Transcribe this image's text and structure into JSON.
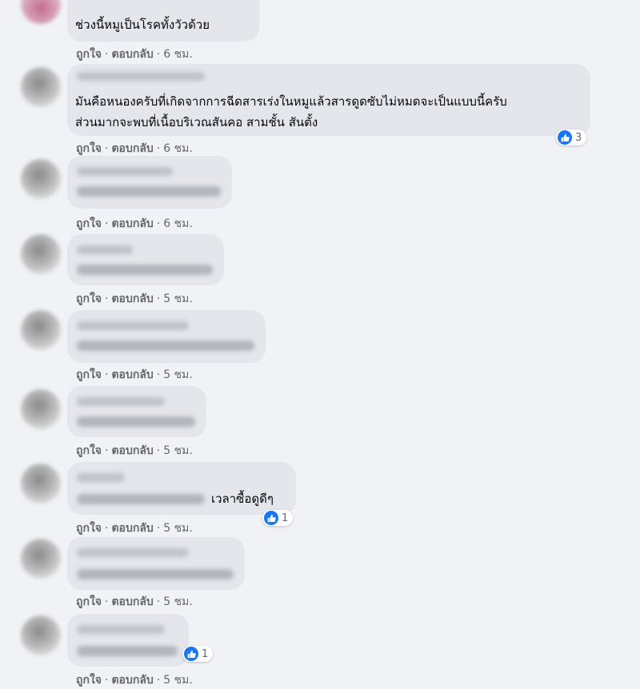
{
  "comments": [
    {
      "text_lines": [
        "ช่วงนี้หมูเป็นโรคทั้งวัวด้วย"
      ],
      "like": "ถูกใจ",
      "reply": "ตอบกลับ",
      "time": "6 ชม."
    },
    {
      "text_lines": [
        "มันคือหนองครับที่เกิดจากการฉีดสารเร่งในหมูแล้วสารดูดซับไม่หมดจะเป็นแบบนี้ครับ",
        "ส่วนมากจะพบที่เนื้อบริเวณสันคอ สามชั้น สันตั้ง"
      ],
      "reaction_count": "3",
      "like": "ถูกใจ",
      "reply": "ตอบกลับ",
      "time": "6 ชม."
    },
    {
      "like": "ถูกใจ",
      "reply": "ตอบกลับ",
      "time": "6 ชม."
    },
    {
      "like": "ถูกใจ",
      "reply": "ตอบกลับ",
      "time": "5 ชม."
    },
    {
      "like": "ถูกใจ",
      "reply": "ตอบกลับ",
      "time": "5 ชม."
    },
    {
      "like": "ถูกใจ",
      "reply": "ตอบกลับ",
      "time": "5 ชม."
    },
    {
      "text_lines": [
        "เวลาซื้อดูดีๆ"
      ],
      "reaction_count": "1",
      "like": "ถูกใจ",
      "reply": "ตอบกลับ",
      "time": "5 ชม."
    },
    {
      "like": "ถูกใจ",
      "reply": "ตอบกลับ",
      "time": "5 ชม."
    },
    {
      "reaction_count": "1",
      "like": "ถูกใจ",
      "reply": "ตอบกลับ",
      "time": "5 ชม."
    }
  ],
  "separator": "·",
  "icons": {
    "reaction": "like-thumb-icon"
  },
  "colors": {
    "like_blue": "#1877f2",
    "bubble": "#e4e6eb",
    "background": "#f0f2f5",
    "meta_text": "#65676b"
  }
}
